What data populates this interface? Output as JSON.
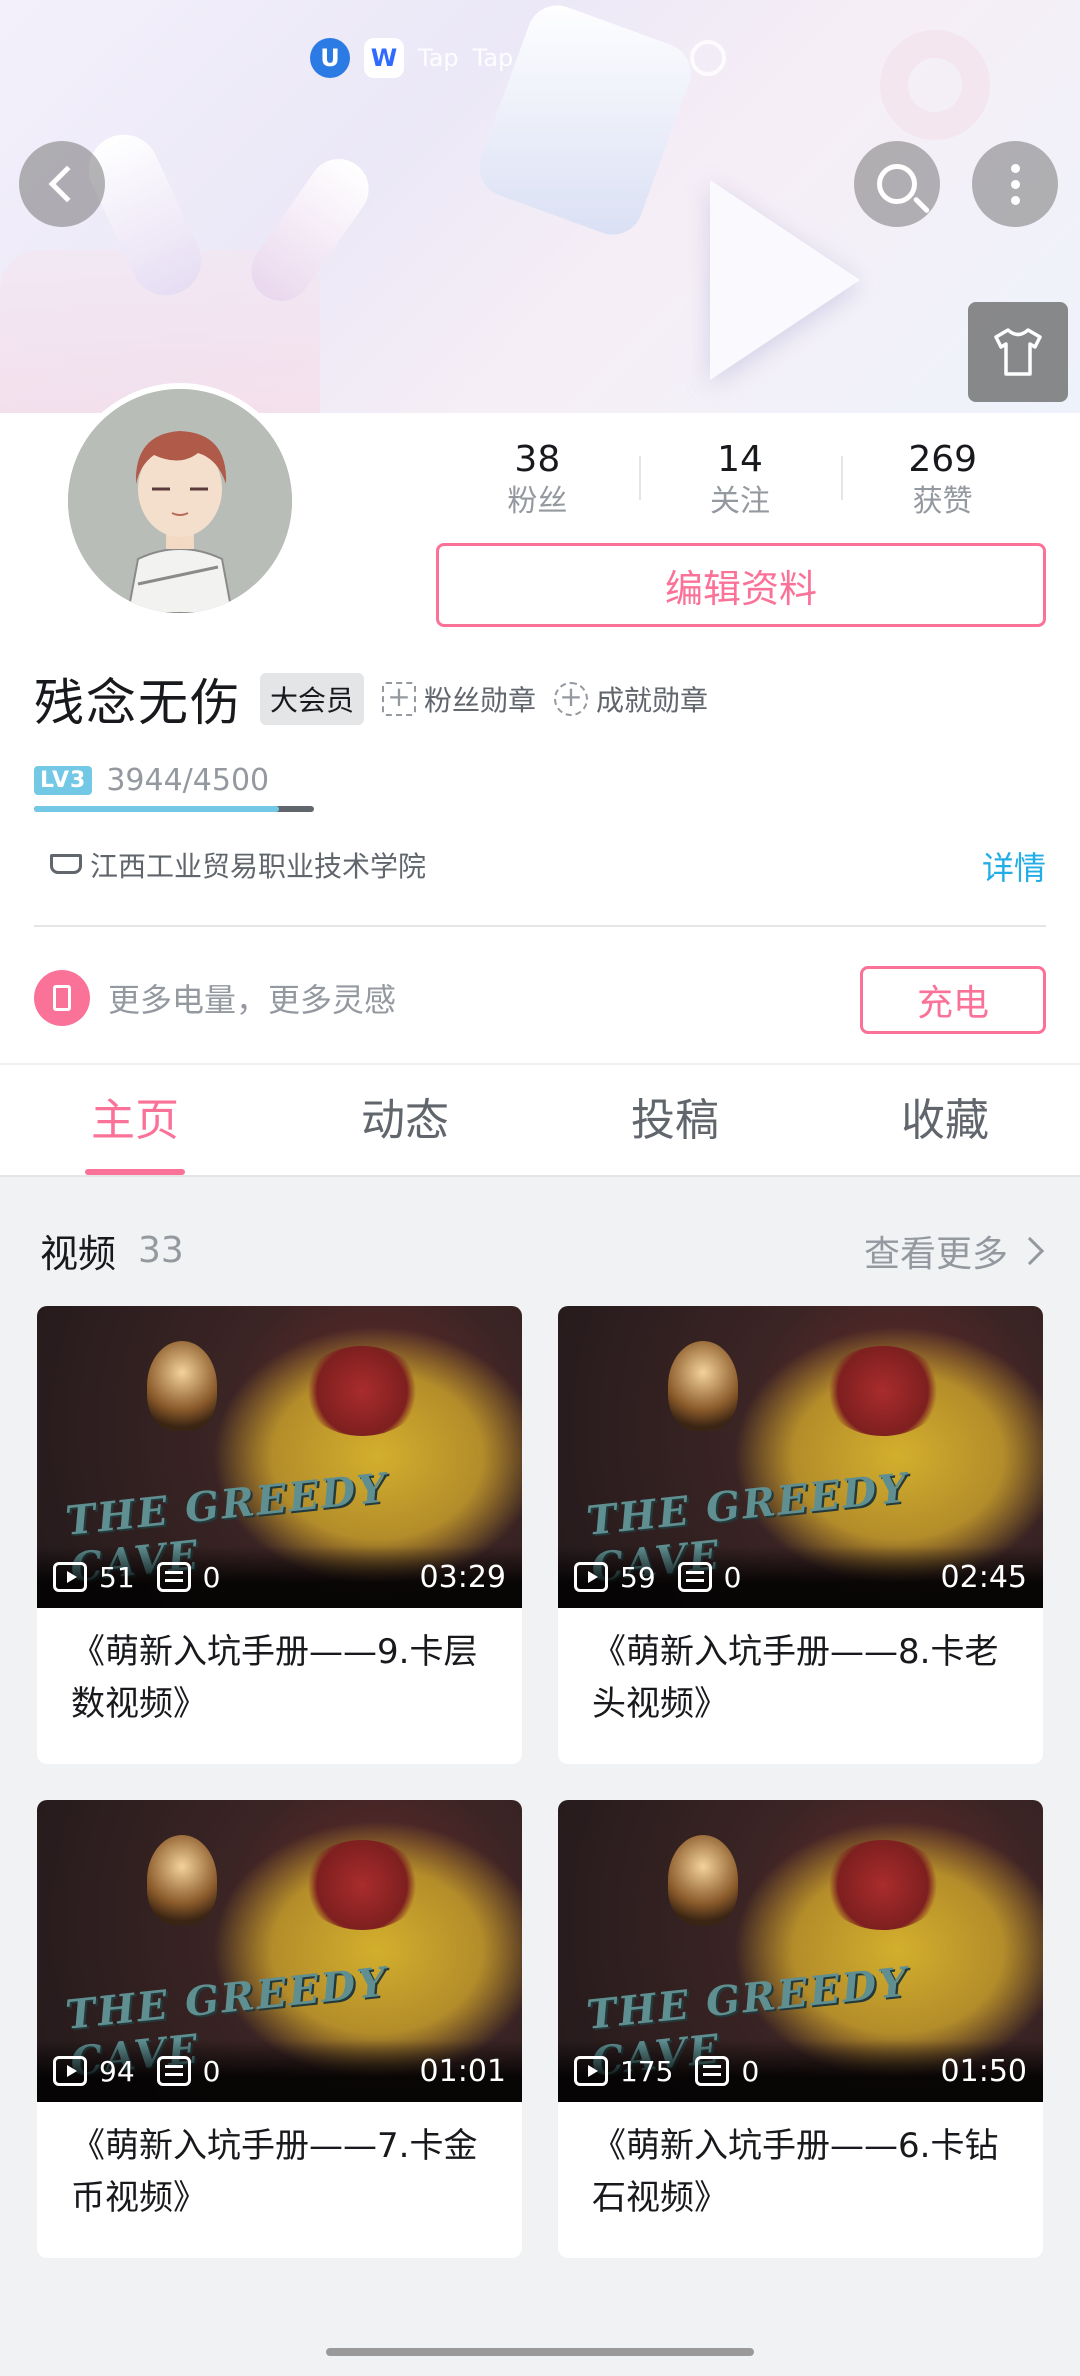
{
  "status_bar": {
    "apps": [
      "U",
      "W"
    ],
    "texts": [
      "Tap",
      "Tap"
    ]
  },
  "header": {
    "back": "back",
    "search": "search",
    "more": "more",
    "dress": "shirt"
  },
  "profile": {
    "stats": [
      {
        "num": "38",
        "label": "粉丝"
      },
      {
        "num": "14",
        "label": "关注"
      },
      {
        "num": "269",
        "label": "获赞"
      }
    ],
    "edit_label": "编辑资料",
    "username": "残念无伤",
    "vip_tag": "大会员",
    "fan_medal": "粉丝勋章",
    "achievement_medal": "成就勋章",
    "level_badge": "LV3",
    "level_progress_text": "3944/4500",
    "level_progress_fraction": 0.876,
    "school": "江西工业贸易职业技术学院",
    "detail_link": "详情",
    "charge_text": "更多电量，更多灵感",
    "charge_button": "充电"
  },
  "tabs": [
    {
      "label": "主页",
      "active": true
    },
    {
      "label": "动态",
      "active": false
    },
    {
      "label": "投稿",
      "active": false
    },
    {
      "label": "收藏",
      "active": false
    }
  ],
  "videos_section": {
    "title": "视频",
    "count": "33",
    "see_more": "查看更多",
    "logo_text": "THE GREEDY CAVE",
    "items": [
      {
        "plays": "51",
        "danmaku": "0",
        "duration": "03:29",
        "title": "《萌新入坑手册——9.卡层数视频》"
      },
      {
        "plays": "59",
        "danmaku": "0",
        "duration": "02:45",
        "title": "《萌新入坑手册——8.卡老头视频》"
      },
      {
        "plays": "94",
        "danmaku": "0",
        "duration": "01:01",
        "title": "《萌新入坑手册——7.卡金币视频》"
      },
      {
        "plays": "175",
        "danmaku": "0",
        "duration": "01:50",
        "title": "《萌新入坑手册——6.卡钻石视频》"
      }
    ]
  },
  "colors": {
    "accent": "#fb7299",
    "link": "#23ade5",
    "level": "#73c9e5"
  }
}
